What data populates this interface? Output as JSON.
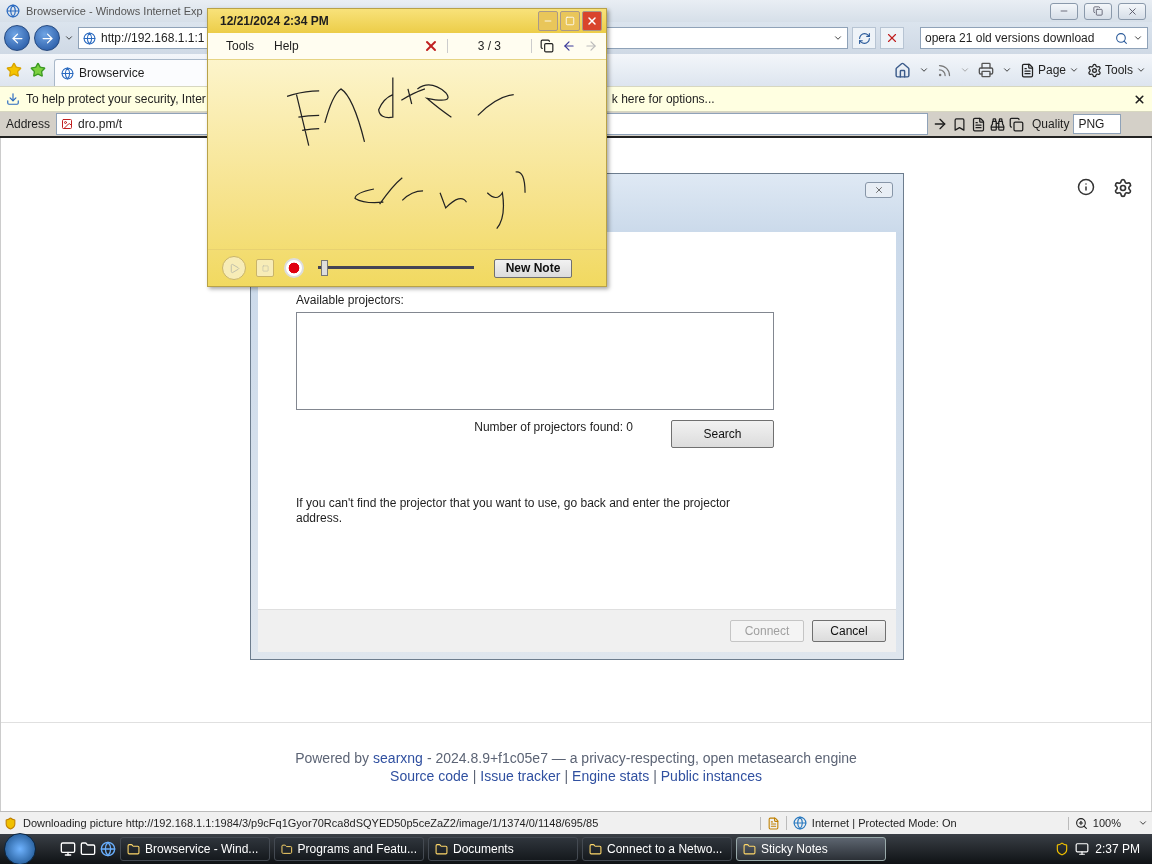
{
  "browser": {
    "title": "Browservice - Windows Internet Exp",
    "address": "http://192.168.1.1:1",
    "search": "opera 21 old versions download",
    "tab": {
      "label": "Browservice",
      "selected": true
    },
    "commands": [
      "Page",
      "Tools"
    ],
    "infobar": {
      "left": "To help protect your security, Inter",
      "right": "k here for options..."
    },
    "address_toolbar": {
      "label": "Address",
      "value": "dro.pm/t",
      "quality_label": "Quality",
      "quality": "PNG"
    }
  },
  "dialog": {
    "list_label": "Available projectors:",
    "found": "Number of projectors found: 0",
    "search_button": "Search",
    "hint": "If you can't find the projector that you want to use, go back and enter the projector address.",
    "buttons": [
      {
        "label": "Connect",
        "disabled": true
      },
      {
        "label": "Cancel",
        "disabled": false
      }
    ]
  },
  "footer": {
    "prefix": "Powered by",
    "link": "searxng",
    "suffix": "- 2024.8.9+f1c05e7 — a privacy-respecting, open metasearch engine",
    "separator": "|",
    "links": [
      "Source code",
      "Issue tracker",
      "Engine stats",
      "Public instances"
    ]
  },
  "sticky_note": {
    "title": "12/21/2024 2:34 PM",
    "menu": [
      "Tools",
      "Help"
    ],
    "page": "3 / 3",
    "playback": {
      "level": 0.02
    },
    "new_button": "New Note"
  },
  "status_bar": {
    "text": "Downloading picture http://192.168.1.1:1984/3/p9cFq1Gyor70Rca8dSQYED50p5ceZaZ2/image/1/1374/0/1148/695/85",
    "zone": "Internet | Protected Mode: On",
    "zoom": "100%"
  },
  "taskbar": {
    "items": [
      {
        "label": "Browservice - Wind...",
        "selected": false
      },
      {
        "label": "Programs and Featu...",
        "selected": false
      },
      {
        "label": "Documents",
        "selected": false
      },
      {
        "label": "Connect to a Netwo...",
        "selected": false
      },
      {
        "label": "Sticky Notes",
        "selected": true
      }
    ],
    "clock": "2:37 PM"
  }
}
